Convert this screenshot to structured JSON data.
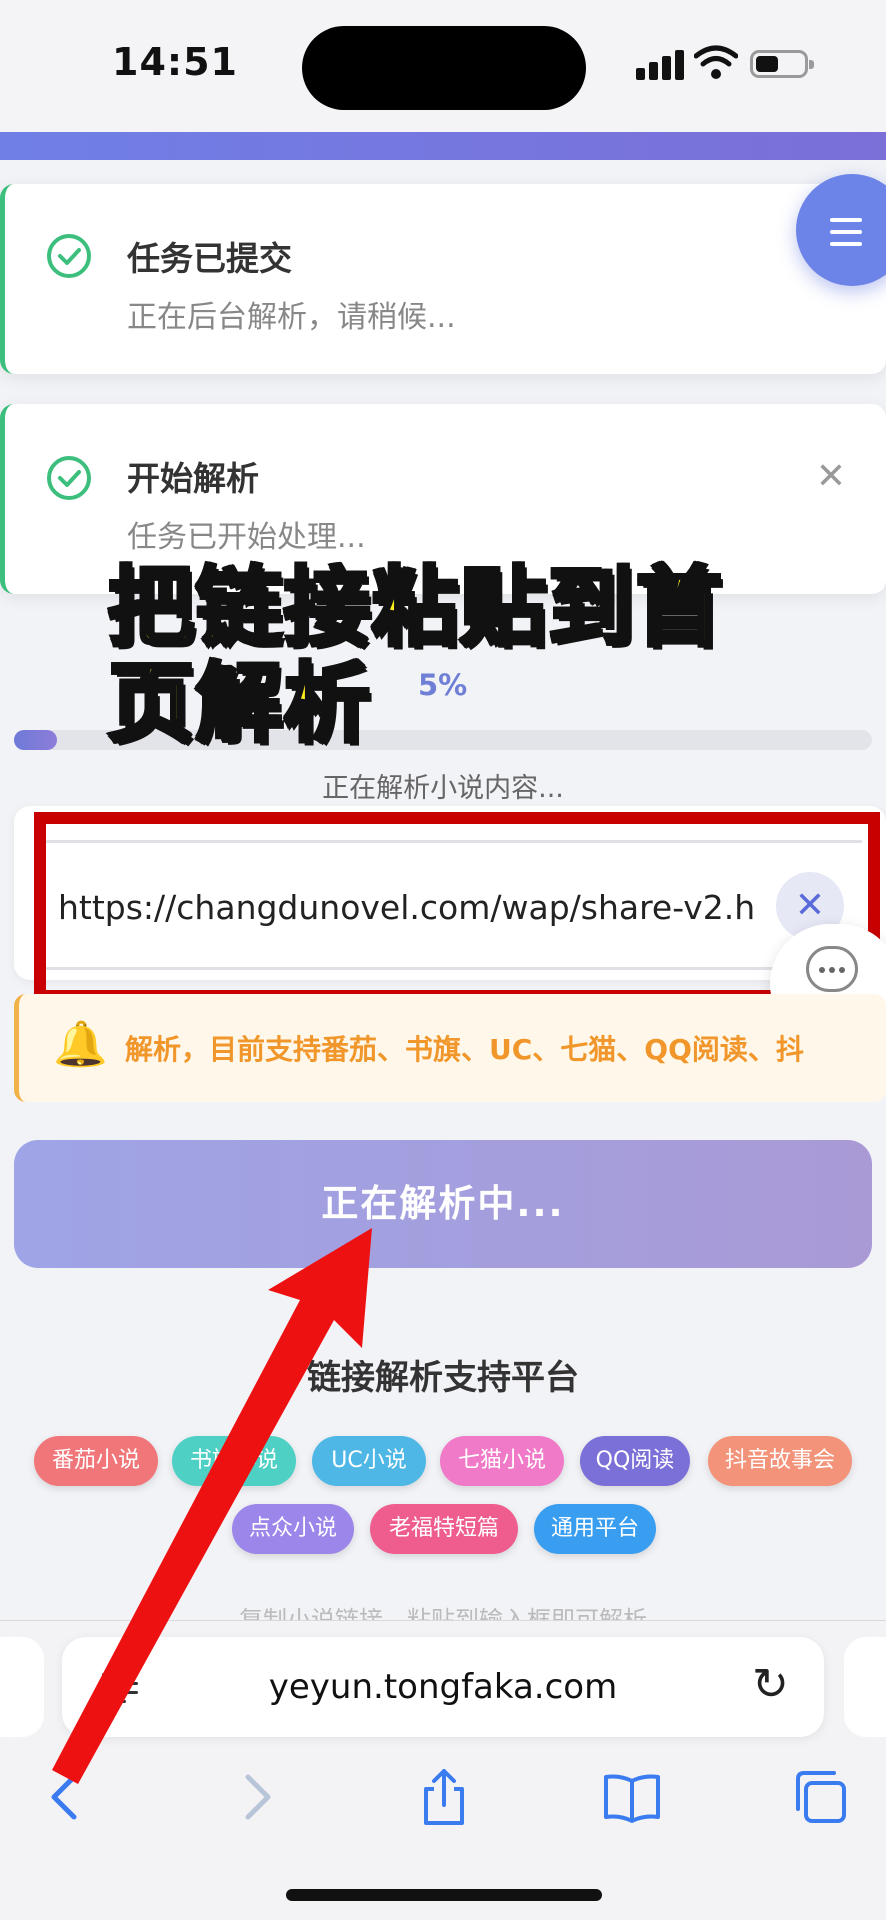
{
  "status_bar": {
    "time": "14:51"
  },
  "toasts": [
    {
      "title": "任务已提交",
      "message": "正在后台解析，请稍候..."
    },
    {
      "title": "开始解析",
      "message": "任务已开始处理..."
    }
  ],
  "overlay_caption": "把链接粘贴到首页解析",
  "progress": {
    "percent_label": "5%",
    "fraction": 0.05,
    "status_text": "正在解析小说内容..."
  },
  "url_input": {
    "value": "https://changdunovel.com/wap/share-v2.h"
  },
  "customer_service": {
    "label": "客服"
  },
  "notice": {
    "text": "解析，目前支持番茄、书旗、UC、七猫、QQ阅读、抖"
  },
  "parse_button": {
    "label": "正在解析中..."
  },
  "platforms": {
    "title": "链接解析支持平台",
    "chips": [
      {
        "label": "番茄小说",
        "color": "#f0767a"
      },
      {
        "label": "书旗小说",
        "color": "#4fd0c4"
      },
      {
        "label": "UC小说",
        "color": "#4fb7e6"
      },
      {
        "label": "七猫小说",
        "color": "#f07ac8"
      },
      {
        "label": "QQ阅读",
        "color": "#7b6fd8"
      },
      {
        "label": "抖音故事会",
        "color": "#f3937a"
      },
      {
        "label": "点众小说",
        "color": "#9c86ea"
      },
      {
        "label": "老福特短篇",
        "color": "#ee5d8d"
      },
      {
        "label": "通用平台",
        "color": "#3a9ef0"
      }
    ]
  },
  "bottom_hint": "复制小说链接，粘贴到输入框即可解析",
  "safari": {
    "address": "yeyun.tongfaka.com"
  }
}
